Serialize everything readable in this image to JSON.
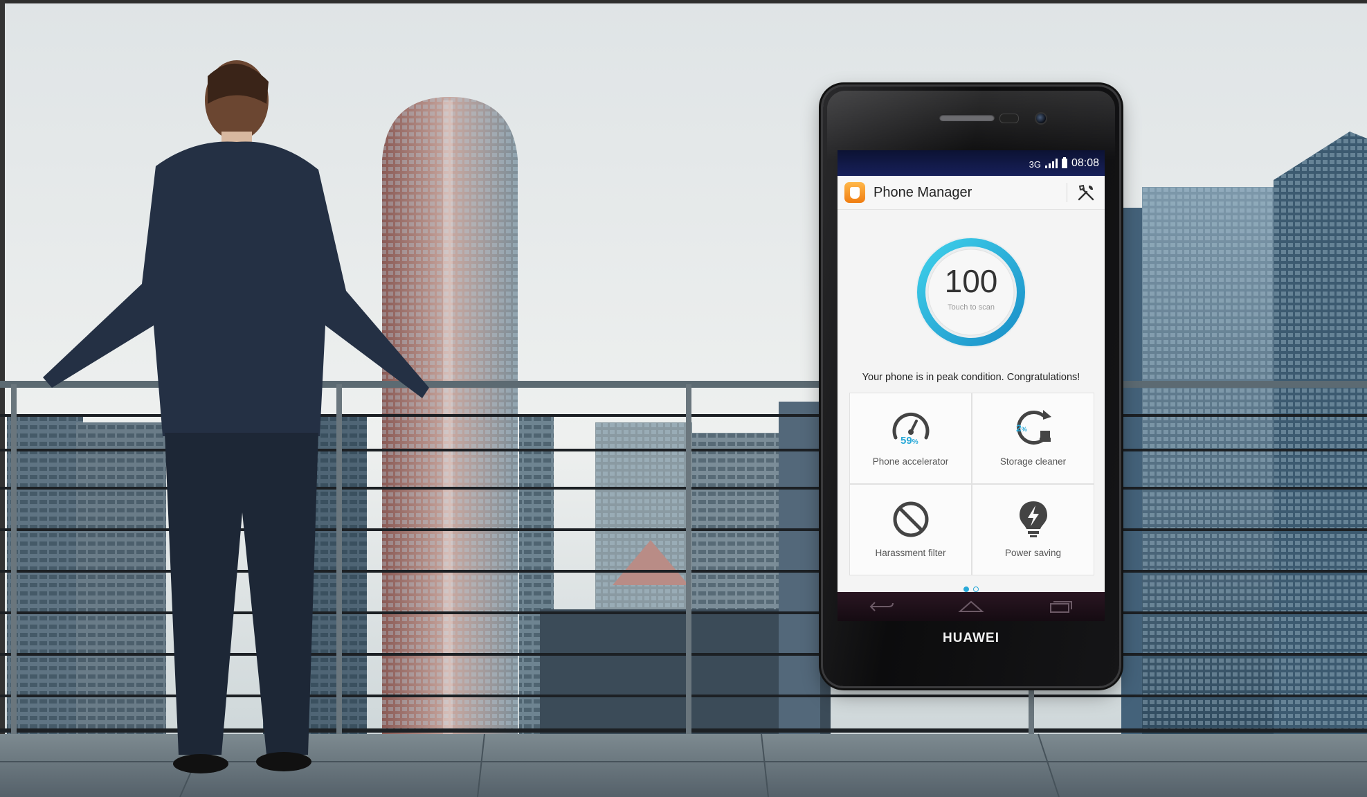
{
  "statusbar": {
    "network": "3G",
    "time": "08:08"
  },
  "app": {
    "title": "Phone Manager",
    "tools_icon": "tools-icon",
    "app_icon": "phone-manager-icon"
  },
  "scan": {
    "score": "100",
    "hint": "Touch to scan",
    "level": 1.0
  },
  "message": "Your phone is in peak condition. Congratulations!",
  "tiles": [
    {
      "label": "Phone accelerator",
      "icon": "speedometer-icon",
      "value": "59",
      "unit": "%"
    },
    {
      "label": "Storage cleaner",
      "icon": "broom-icon",
      "value": "2",
      "unit": "%"
    },
    {
      "label": "Harassment filter",
      "icon": "block-icon"
    },
    {
      "label": "Power saving",
      "icon": "lightning-icon"
    }
  ],
  "pager": {
    "pages": 2,
    "current": 1
  },
  "nav": {
    "back_icon": "back-icon",
    "home_icon": "home-icon",
    "recents_icon": "recents-icon"
  },
  "brand": "HUAWEI",
  "colors": {
    "accent": "#29a9d8",
    "statusbar": "#101848",
    "navbar": "#1f1019",
    "app_icon": "#f39420"
  }
}
